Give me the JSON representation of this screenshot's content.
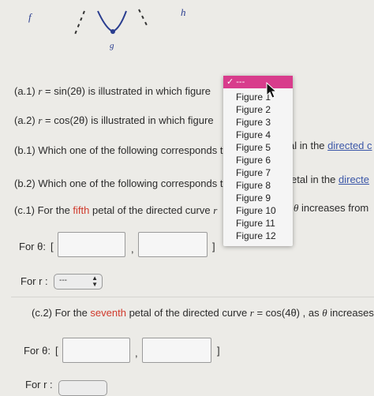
{
  "graph_labels": {
    "f": "f",
    "g": "g",
    "h": "h"
  },
  "questions": {
    "a1": {
      "label": "(a.1)",
      "eq_lhs": "r",
      "eq_rhs": "= sin(2θ)",
      "text": "is illustrated in which figure"
    },
    "a2": {
      "label": "(a.2)",
      "eq_lhs": "r",
      "eq_rhs": "= cos(2θ)",
      "text": "is illustrated in which figure"
    },
    "b1": {
      "text_left": "(b.1) Which one of the following corresponds t",
      "text_right": "al in the ",
      "link": "directed c"
    },
    "b2": {
      "text_left": "(b.2) Which one of the following corresponds t",
      "text_right": "etal in the ",
      "link": "directe"
    },
    "c1": {
      "text_a": "(c.1) For the ",
      "ordinal": "fifth",
      "text_b": " petal of the directed curve ",
      "var": "r",
      "text_right_var": "θ",
      "text_right": " increases from"
    },
    "c2": {
      "text_a": "(c.2) For the ",
      "ordinal": "seventh",
      "text_b": " petal of the directed curve ",
      "eq_lhs": "r",
      "eq_rhs": " = cos(4θ)",
      "text_c": " , as ",
      "theta": "θ",
      "text_d": " increases f"
    }
  },
  "c1_inputs": {
    "for_theta_label": "For θ:",
    "open_bracket": "[",
    "comma": ",",
    "close_bracket": "]",
    "for_r_label": "For r :",
    "r_select_value": "---"
  },
  "c2_inputs": {
    "for_theta_label": "For θ:",
    "open_bracket": "[",
    "comma": ",",
    "close_bracket": "]",
    "for_r_label": "For r :"
  },
  "dropdown": {
    "selected": "✓ ---",
    "options": [
      "Figure 1",
      "Figure 2",
      "Figure 3",
      "Figure 4",
      "Figure 5",
      "Figure 6",
      "Figure 7",
      "Figure 8",
      "Figure 9",
      "Figure 10",
      "Figure 11",
      "Figure 12"
    ]
  },
  "colors": {
    "selected_bg": "#d83c8c",
    "ordinal_red": "#d03a2c",
    "link_blue": "#3a56a8",
    "curve_blue": "#2a3d8f"
  }
}
